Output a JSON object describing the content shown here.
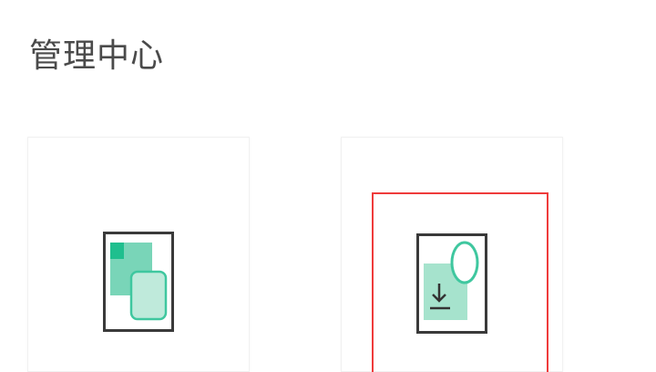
{
  "header": {
    "title": "管理中心"
  },
  "cards": [
    {
      "icon": "multi-document-icon"
    },
    {
      "icon": "download-document-icon"
    }
  ],
  "colors": {
    "accent": "#79d5b8",
    "accent_dark": "#1fbf8e",
    "frame": "#3a3a3a",
    "highlight": "#ef3b3b",
    "title_text": "#4a4a4a"
  }
}
